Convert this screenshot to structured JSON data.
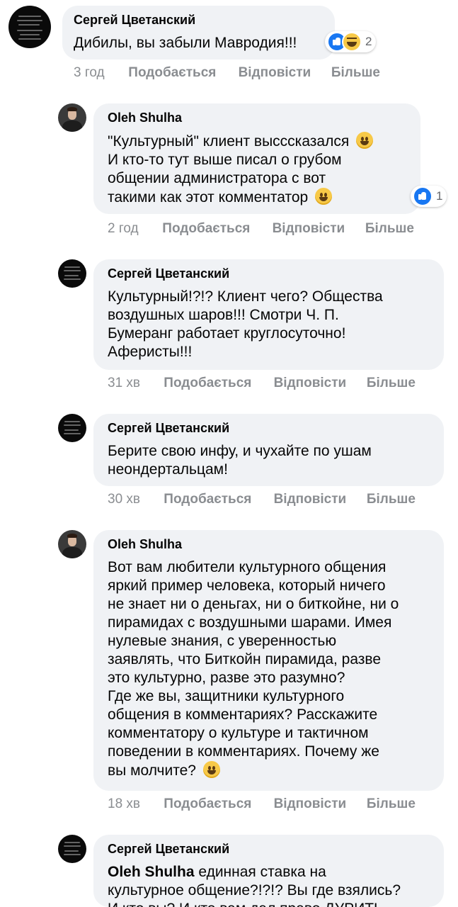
{
  "comments": [
    {
      "author": "Сергей Цветанский",
      "text": "Дибилы, вы забыли Мавродия!!!",
      "time": "3 год",
      "reactions_count": "2",
      "reactions": [
        "like-icon",
        "haha-icon"
      ]
    },
    {
      "author": "Oleh Shulha",
      "lines": [
        "\"Культурный\" клиент высссказался",
        "И кто-то тут выше писал о грубом",
        "общении администратора с вот",
        "такими как этот комментатор"
      ],
      "time": "2 год",
      "reactions_count": "1",
      "reactions": [
        "like-icon"
      ]
    },
    {
      "author": "Сергей Цветанский",
      "lines": [
        "Культурный!?!? Клиент чего? Общества",
        "воздушных шаров!!! Смотри Ч. П.",
        "Бумеранг работает круглосуточно!",
        "Аферисты!!!"
      ],
      "time": "31 хв"
    },
    {
      "author": "Сергей Цветанский",
      "lines": [
        "Берите свою инфу, и чухайте по ушам",
        "неондертальцам!"
      ],
      "time": "30 хв"
    },
    {
      "author": "Oleh Shulha",
      "lines": [
        "Вот вам любители культурного общения",
        "яркий пример человека, который ничего",
        "не знает ни о деньгах, ни о биткойне, ни о",
        "пирамидах с воздушными шарами. Имея",
        "нулевые знания, с уверенностью",
        "заявлять, что Биткойн пирамида, разве",
        "это культурно, разве это разумно?",
        "Где же вы, защитники культурного",
        "общения в комментариях? Расскажите",
        "комментатору о культуре и тактичном",
        "поведении в комментариях. Почему же",
        "вы молчите?"
      ],
      "time": "18 хв"
    },
    {
      "author": "Сергей Цветанский",
      "mention": "Oleh Shulha",
      "lines": [
        " единная ставка на",
        "культурное общение?!?!? Вы где взялись?",
        "И кто вы? И кто вам дал право ДУРИТЬ"
      ]
    }
  ],
  "actions": {
    "like": "Подобається",
    "reply": "Відповісти",
    "more": "Більше"
  },
  "colors": {
    "bubble": "#f0f2f5",
    "meta": "#8a8d91",
    "like": "#1877f2"
  }
}
